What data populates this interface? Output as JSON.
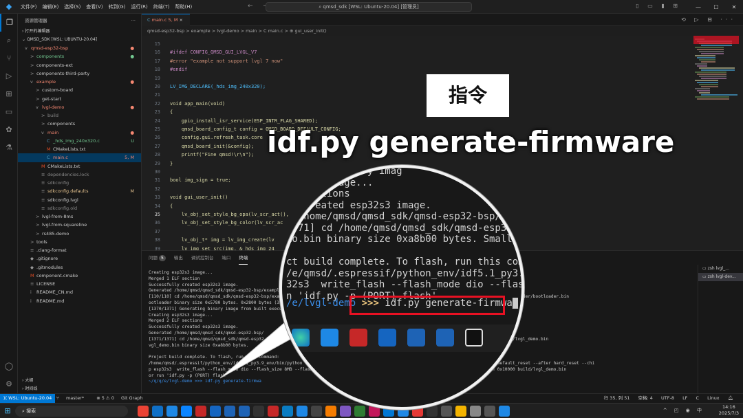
{
  "titlebar": {
    "menus": [
      "文件(F)",
      "编辑(E)",
      "选择(S)",
      "查看(V)",
      "转到(G)",
      "运行(R)",
      "终端(T)",
      "帮助(H)"
    ],
    "command_center": "qmsd_sdk [WSL: Ubuntu-20.04] [管理员]",
    "window_controls": [
      "—",
      "☐",
      "✕"
    ]
  },
  "sidebar": {
    "title": "资源管理器",
    "open_editors": "打开的编辑器",
    "root": "QMSD_SDK [WSL: UBUNTU-20.04]",
    "tree": [
      {
        "label": "qmsd-esp32-bsp",
        "indent": 0,
        "arrow": "v",
        "color": "red",
        "badge": "●",
        "badge_color": "red"
      },
      {
        "label": "components",
        "indent": 1,
        "arrow": ">",
        "color": "green",
        "badge": "●",
        "badge_color": "green"
      },
      {
        "label": "components-ext",
        "indent": 1,
        "arrow": ">",
        "color": "normal",
        "badge": "",
        "badge_color": ""
      },
      {
        "label": "components-third-party",
        "indent": 1,
        "arrow": ">",
        "color": "normal",
        "badge": "",
        "badge_color": ""
      },
      {
        "label": "example",
        "indent": 1,
        "arrow": "v",
        "color": "red",
        "badge": "●",
        "badge_color": "red"
      },
      {
        "label": "custom-board",
        "indent": 2,
        "arrow": ">",
        "color": "normal",
        "badge": "",
        "badge_color": ""
      },
      {
        "label": "get-start",
        "indent": 2,
        "arrow": ">",
        "color": "normal",
        "badge": "",
        "badge_color": ""
      },
      {
        "label": "lvgl-demo",
        "indent": 2,
        "arrow": "v",
        "color": "red",
        "badge": "●",
        "badge_color": "red"
      },
      {
        "label": "build",
        "indent": 3,
        "arrow": ">",
        "color": "gray",
        "badge": "",
        "badge_color": ""
      },
      {
        "label": "components",
        "indent": 3,
        "arrow": ">",
        "color": "normal",
        "badge": "",
        "badge_color": ""
      },
      {
        "label": "main",
        "indent": 3,
        "arrow": "v",
        "color": "red",
        "badge": "●",
        "badge_color": "red"
      },
      {
        "label": "_hds_img_240x320.c",
        "indent": 4,
        "arrow": "C",
        "color": "green",
        "badge": "U",
        "badge_color": "green"
      },
      {
        "label": "CMakeLists.txt",
        "indent": 4,
        "arrow": "M",
        "color": "normal",
        "badge": "",
        "badge_color": ""
      },
      {
        "label": "main.c",
        "indent": 4,
        "arrow": "C",
        "color": "red",
        "badge": "5, M",
        "badge_color": "red",
        "selected": true
      },
      {
        "label": "CMakeLists.txt",
        "indent": 3,
        "arrow": "M",
        "color": "normal",
        "badge": "",
        "badge_color": ""
      },
      {
        "label": "dependencies.lock",
        "indent": 3,
        "arrow": "≡",
        "color": "gray",
        "badge": "",
        "badge_color": ""
      },
      {
        "label": "sdkconfig",
        "indent": 3,
        "arrow": "≡",
        "color": "gray",
        "badge": "",
        "badge_color": ""
      },
      {
        "label": "sdkconfig.defaults",
        "indent": 3,
        "arrow": "≡",
        "color": "orange",
        "badge": "M",
        "badge_color": "orange"
      },
      {
        "label": "sdkconfig.lvgl",
        "indent": 3,
        "arrow": "≡",
        "color": "normal",
        "badge": "",
        "badge_color": ""
      },
      {
        "label": "sdkconfig.old",
        "indent": 3,
        "arrow": "≡",
        "color": "gray",
        "badge": "",
        "badge_color": ""
      },
      {
        "label": "lvgl-from-8ms",
        "indent": 2,
        "arrow": ">",
        "color": "normal",
        "badge": "",
        "badge_color": ""
      },
      {
        "label": "lvgl-from-squareline",
        "indent": 2,
        "arrow": ">",
        "color": "normal",
        "badge": "",
        "badge_color": ""
      },
      {
        "label": "rs485-demo",
        "indent": 2,
        "arrow": ">",
        "color": "normal",
        "badge": "",
        "badge_color": ""
      },
      {
        "label": "tools",
        "indent": 1,
        "arrow": ">",
        "color": "normal",
        "badge": "",
        "badge_color": ""
      },
      {
        "label": ".clang-format",
        "indent": 1,
        "arrow": "≡",
        "color": "normal",
        "badge": "",
        "badge_color": ""
      },
      {
        "label": ".gitignore",
        "indent": 1,
        "arrow": "◆",
        "color": "normal",
        "badge": "",
        "badge_color": ""
      },
      {
        "label": ".gitmodules",
        "indent": 1,
        "arrow": "◆",
        "color": "normal",
        "badge": "",
        "badge_color": ""
      },
      {
        "label": "component.cmake",
        "indent": 1,
        "arrow": "M",
        "color": "normal",
        "badge": "",
        "badge_color": ""
      },
      {
        "label": "LICENSE",
        "indent": 1,
        "arrow": "≡",
        "color": "normal",
        "badge": "",
        "badge_color": ""
      },
      {
        "label": "README_CN.md",
        "indent": 1,
        "arrow": "i",
        "color": "normal",
        "badge": "",
        "badge_color": ""
      },
      {
        "label": "README.md",
        "indent": 1,
        "arrow": "i",
        "color": "normal",
        "badge": "",
        "badge_color": ""
      }
    ],
    "outline": "大纲",
    "timeline": "时间线"
  },
  "editor": {
    "tab_label": "main.c 5, M",
    "breadcrumb": "qmsd-esp32-bsp > example > lvgl-demo > main > C main.c > ⊕ gui_user_init()",
    "lines": [
      {
        "n": "15",
        "t": ""
      },
      {
        "n": "16",
        "t": "#ifdef CONFIG_QMSD_GUI_LVGL_V7"
      },
      {
        "n": "17",
        "t": "#error \"example not support lvgl 7 now\""
      },
      {
        "n": "18",
        "t": "#endif"
      },
      {
        "n": "19",
        "t": ""
      },
      {
        "n": "20",
        "t": "LV_IMG_DECLARE(_hds_img_240x320);"
      },
      {
        "n": "21",
        "t": ""
      },
      {
        "n": "22",
        "t": "void app_main(void)"
      },
      {
        "n": "23",
        "t": "{"
      },
      {
        "n": "24",
        "t": "    gpio_install_isr_service(ESP_INTR_FLAG_SHARED);"
      },
      {
        "n": "25",
        "t": "    qmsd_board_config_t config = QMSD_BOARD_DEFAULT_CONFIG;"
      },
      {
        "n": "26",
        "t": "    config.gui.refresh_task.core"
      },
      {
        "n": "27",
        "t": "    qmsd_board_init(&config);"
      },
      {
        "n": "28",
        "t": "    printf(\"Fine qmsd!\\r\\n\");"
      },
      {
        "n": "29",
        "t": "}"
      },
      {
        "n": "30",
        "t": ""
      },
      {
        "n": "31",
        "t": "bool img_sign = true;"
      },
      {
        "n": "32",
        "t": ""
      },
      {
        "n": "33",
        "t": "void gui_user_init()"
      },
      {
        "n": "34",
        "t": "{"
      },
      {
        "n": "35",
        "t": "    lv_obj_set_style_bg_opa(lv_scr_act(),"
      },
      {
        "n": "36",
        "t": "    lv_obj_set_style_bg_color(lv_scr_ac"
      },
      {
        "n": "37",
        "t": ""
      },
      {
        "n": "38",
        "t": "    lv_obj_t* img = lv_img_create(lv"
      },
      {
        "n": "39",
        "t": "    lv_img_set_src(img, & hds_img_24"
      }
    ]
  },
  "panel": {
    "tabs": [
      "问题",
      "输出",
      "调试控制台",
      "端口",
      "终端"
    ],
    "problems_count": "5",
    "terminal_lines": [
      "Creating esp32s3 image...",
      "Merged 1 ELF section",
      "Successfully created esp32s3 image.",
      "Generated /home/qmsd/qmsd_sdk/qmsd-esp32-bsp/example/",
      "[110/110] cd /home/qmsd/qmsd_sdk/qmsd-esp32-bsp/examp                                              /qmsd-esp32-bsp/example/lvgl-demo/build/bootloader/bootloader.bin",
      "ootloader binary size 0x5780 bytes. 0x2800 bytes (32%",
      "[1370/1371] Generating binary image from built executa",
      "Creating esp32s3 image...",
      "Merged 2 ELF sections",
      "Successfully created esp32s3 image.",
      "Generated /home/qmsd/qmsd_sdk/qmsd-esp32-bsp/",
      "[1371/1371] cd /home/qmsd/qmsd_sdk/qmsd-esp32-bsp/                                  /home/qmsd/qmsd_sdk/qmsd-esp32-bsp/example/lvgl-demo/build/lvgl_demo.bin",
      "vgl_demo.bin binary size 0xa8b00 bytes.                   app partition is 0x",
      "",
      "Project build complete. To flash, run this command:",
      "/home/qmsd/.espressif/python_env/idf5.1_py3.9_env/bin/python ../../../../              /esptool/esptool.py -p (PORT) -b 460800 --before default_reset --after hard_reset --chi",
      "p esp32s3  write_flash --flash_mode dio --flash_size 8MB --flash_freq 80m 0x0          0x8000 build/partition_table/partition-table.bin 0x10000 build/lvgl_demo.bin",
      "or run 'idf.py -p (PORT) flash'",
      "~/q/q/e/lvgl-demo >>> idf.py generate-firmwa"
    ],
    "terminals": [
      "zsh  lvgl_...",
      "zsh  lvgl-dev..."
    ]
  },
  "statusbar": {
    "remote": "WSL: Ubuntu-20.04",
    "branch": "master*",
    "problems": "⊗ 5 ⚠ 0",
    "git_graph": "Git Graph",
    "position": "行 35, 列 51",
    "spaces": "空格: 4",
    "encoding": "UTF-8",
    "eol": "LF",
    "language": "C",
    "os": "Linux"
  },
  "taskbar": {
    "search_placeholder": "搜索",
    "time": "14:16",
    "date": "2025/7/3"
  },
  "overlay": {
    "banner": "指令",
    "command": "idf.py generate-firmware"
  },
  "magnifier": {
    "lines": [
      "r    ing binary imag",
      "       image...",
      "   sections",
      "ly created esp32s3 image.",
      "d /home/qmsd/qmsd_sdk/qmsd-esp32-bsp/ex",
      "1371] cd /home/qmsd/qmsd_sdk/qmsd-esp32-bsp",
      "mo.bin binary size 0xa8b00 bytes. Smallest a",
      "",
      "ct build complete. To flash, run this command:",
      "/e/qmsd/.espressif/python_env/idf5.1_py3.9_env/b",
      "32s3  write_flash --flash_mode dio --flash_siz",
      "n 'idf.py -p (PORT) flash'"
    ],
    "prompt": "/e/lvgl-demo",
    "arrows": ">>>",
    "command": "idf.py generate-firmwa"
  },
  "colors": {
    "accent": "#0078d4",
    "highlight_box": "#e81123"
  }
}
